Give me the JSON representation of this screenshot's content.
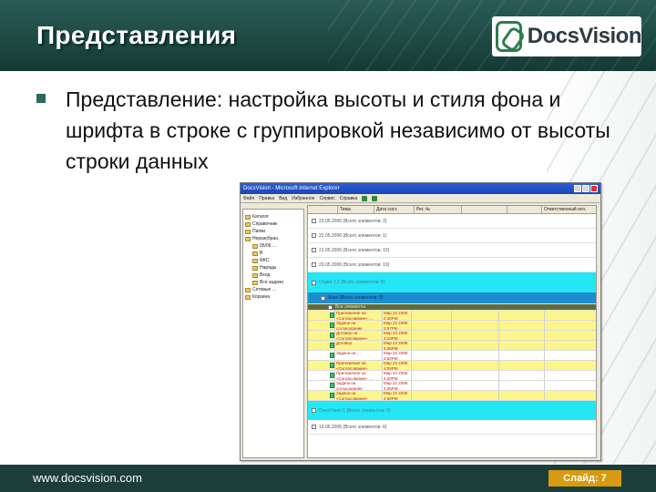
{
  "slide": {
    "title": "Представления",
    "bullet": "Представление: настройка высоты и стиля фона и шрифта в строке с группировкой независимо от высоты строки данных",
    "logo_text": "DocsVision",
    "footer_url": "www.docsvision.com",
    "slide_number": "Слайд: 7",
    "colors": {
      "header": "#1e4a44",
      "footer": "#1c3e3a",
      "slide_badge": "#d89a12",
      "group_cyan": "#25e6f5",
      "group_blue": "#1a8ed0",
      "row_yellow": "#fcf58a"
    }
  },
  "screenshot": {
    "window_title": "DocsVision - Microsoft Internet Explorer",
    "toolbar": [
      "Файл",
      "Правка",
      "Вид",
      "Избранное",
      "Сервис",
      "Справка"
    ],
    "tree": [
      "Каталог",
      "Справочник",
      "Папки",
      "Неразобран.",
      "05/06 …",
      "В",
      "ФКС",
      "Наряды",
      "Вход",
      "Все задачи",
      "Сетевые …",
      "Корзина"
    ],
    "columns": [
      "",
      "Тема",
      "Дата сост.",
      "Рег. №",
      "",
      "",
      "Ответственный исп."
    ],
    "groups": {
      "date1": "23.05.2006 (Всего элементов: 2)",
      "date2": "22.05.2006 (Всего элементов: 1)",
      "date3": "21.05.2006 (Всего элементов: 10)",
      "date4": "20.05.2006 (Всего элементов: 19)",
      "group1": "Отдел 1.1 (Всего элементов: 8)",
      "group2": "Азия (Всего элементов: 8)",
      "group3": "Все элементы",
      "bottom_group": "DocsVision 1 (Всего элементов: 6)",
      "date5": "19.05.2006 (Всего элементов: 6)"
    },
    "rows": [
      {
        "subject": "Приложение на «Согласование» …",
        "date": "Мар 22 2006 2:30PM"
      },
      {
        "subject": "Задача на согласование",
        "date": "Мар 22 2006 2:57PM"
      },
      {
        "subject": "Договор на «Согласование»",
        "date": "Мар 22 2006 3:10PM"
      },
      {
        "subject": "Договор",
        "date": "Мар 22 2006 3:45PM"
      },
      {
        "subject": "Задача на …",
        "date": "Мар 22 2006 3:50PM"
      },
      {
        "subject": "Приложение на «Согласование»",
        "date": "Мар 22 2006 4:05PM"
      },
      {
        "subject": "Приложение на «Согласование» …",
        "date": "Мар 22 2006 4:20PM"
      },
      {
        "subject": "Задача на согласование",
        "date": "Мар 22 2006 4:35PM"
      },
      {
        "subject": "Задача на «Согласование»",
        "date": "Мар 22 2006 4:50PM"
      }
    ]
  }
}
